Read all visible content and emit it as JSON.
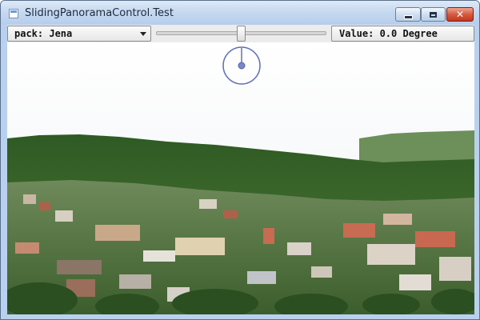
{
  "window": {
    "title": "SlidingPanoramaControl.Test",
    "icon": "app-window-icon",
    "buttons": [
      {
        "name": "minimize",
        "icon": "minimize-icon"
      },
      {
        "name": "maximize",
        "icon": "maximize-icon"
      },
      {
        "name": "close",
        "icon": "close-icon",
        "glyph": "✕"
      }
    ]
  },
  "toolbar": {
    "pack_select": {
      "label": "pack: Jena"
    },
    "slider": {
      "value_fraction": 0.5
    },
    "value_label": "Value: 0.0 Degree"
  },
  "panorama": {
    "compass_icon": "compass-dial-icon",
    "heading_degrees": 0.0,
    "colors": {
      "sky": "#f4f6f8",
      "forest": "#3f6b2e",
      "rooftops": "#b0604a",
      "compass": "#6070b8"
    }
  }
}
